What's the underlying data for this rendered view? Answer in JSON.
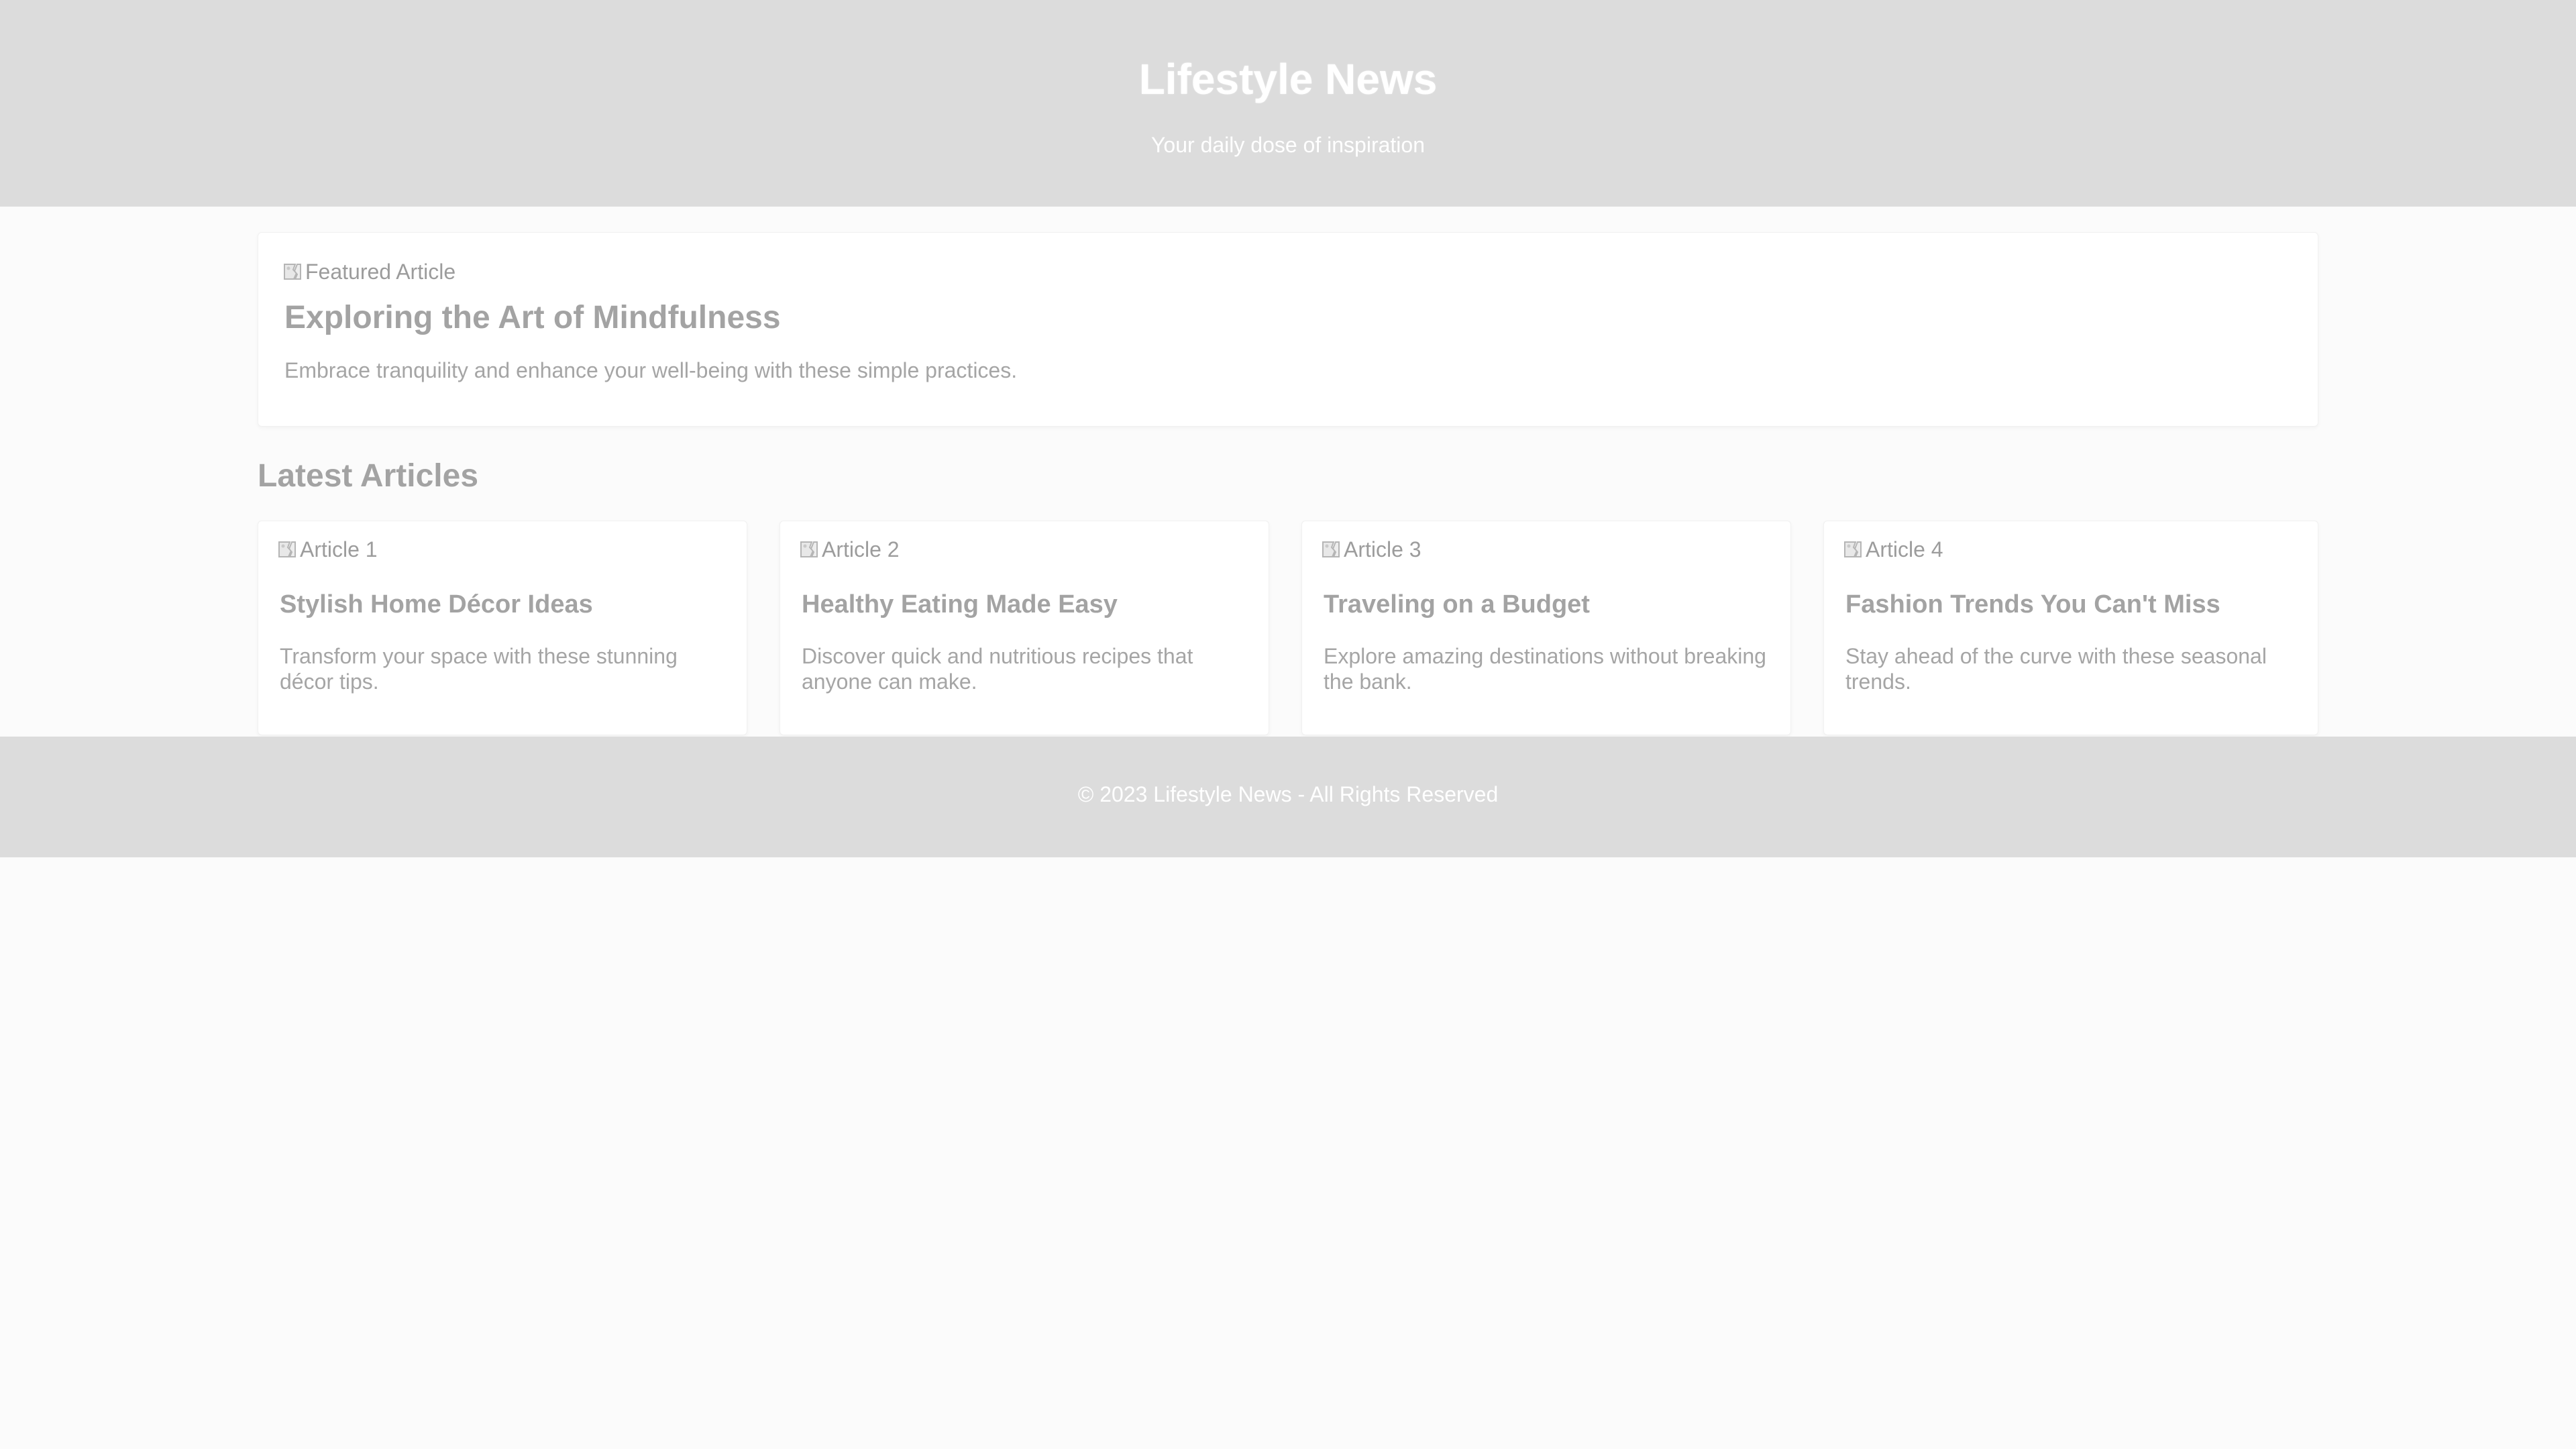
{
  "header": {
    "title": "Lifestyle News",
    "tagline": "Your daily dose of inspiration"
  },
  "featured": {
    "image_alt": "Featured Article",
    "title": "Exploring the Art of Mindfulness",
    "description": "Embrace tranquility and enhance your well-being with these simple practices."
  },
  "latest": {
    "heading": "Latest Articles",
    "articles": [
      {
        "image_alt": "Article 1",
        "title": "Stylish Home Décor Ideas",
        "description": "Transform your space with these stunning décor tips."
      },
      {
        "image_alt": "Article 2",
        "title": "Healthy Eating Made Easy",
        "description": "Discover quick and nutritious recipes that anyone can make."
      },
      {
        "image_alt": "Article 3",
        "title": "Traveling on a Budget",
        "description": "Explore amazing destinations without breaking the bank."
      },
      {
        "image_alt": "Article 4",
        "title": "Fashion Trends You Can't Miss",
        "description": "Stay ahead of the curve with these seasonal trends."
      }
    ]
  },
  "footer": {
    "text": "© 2023 Lifestyle News - All Rights Reserved"
  },
  "icons": {
    "image_placeholder": "broken-image-icon"
  },
  "colors": {
    "header_bg": "#dcdcdc",
    "page_bg": "#fbfbfb",
    "text_muted": "#9a9a9a"
  }
}
